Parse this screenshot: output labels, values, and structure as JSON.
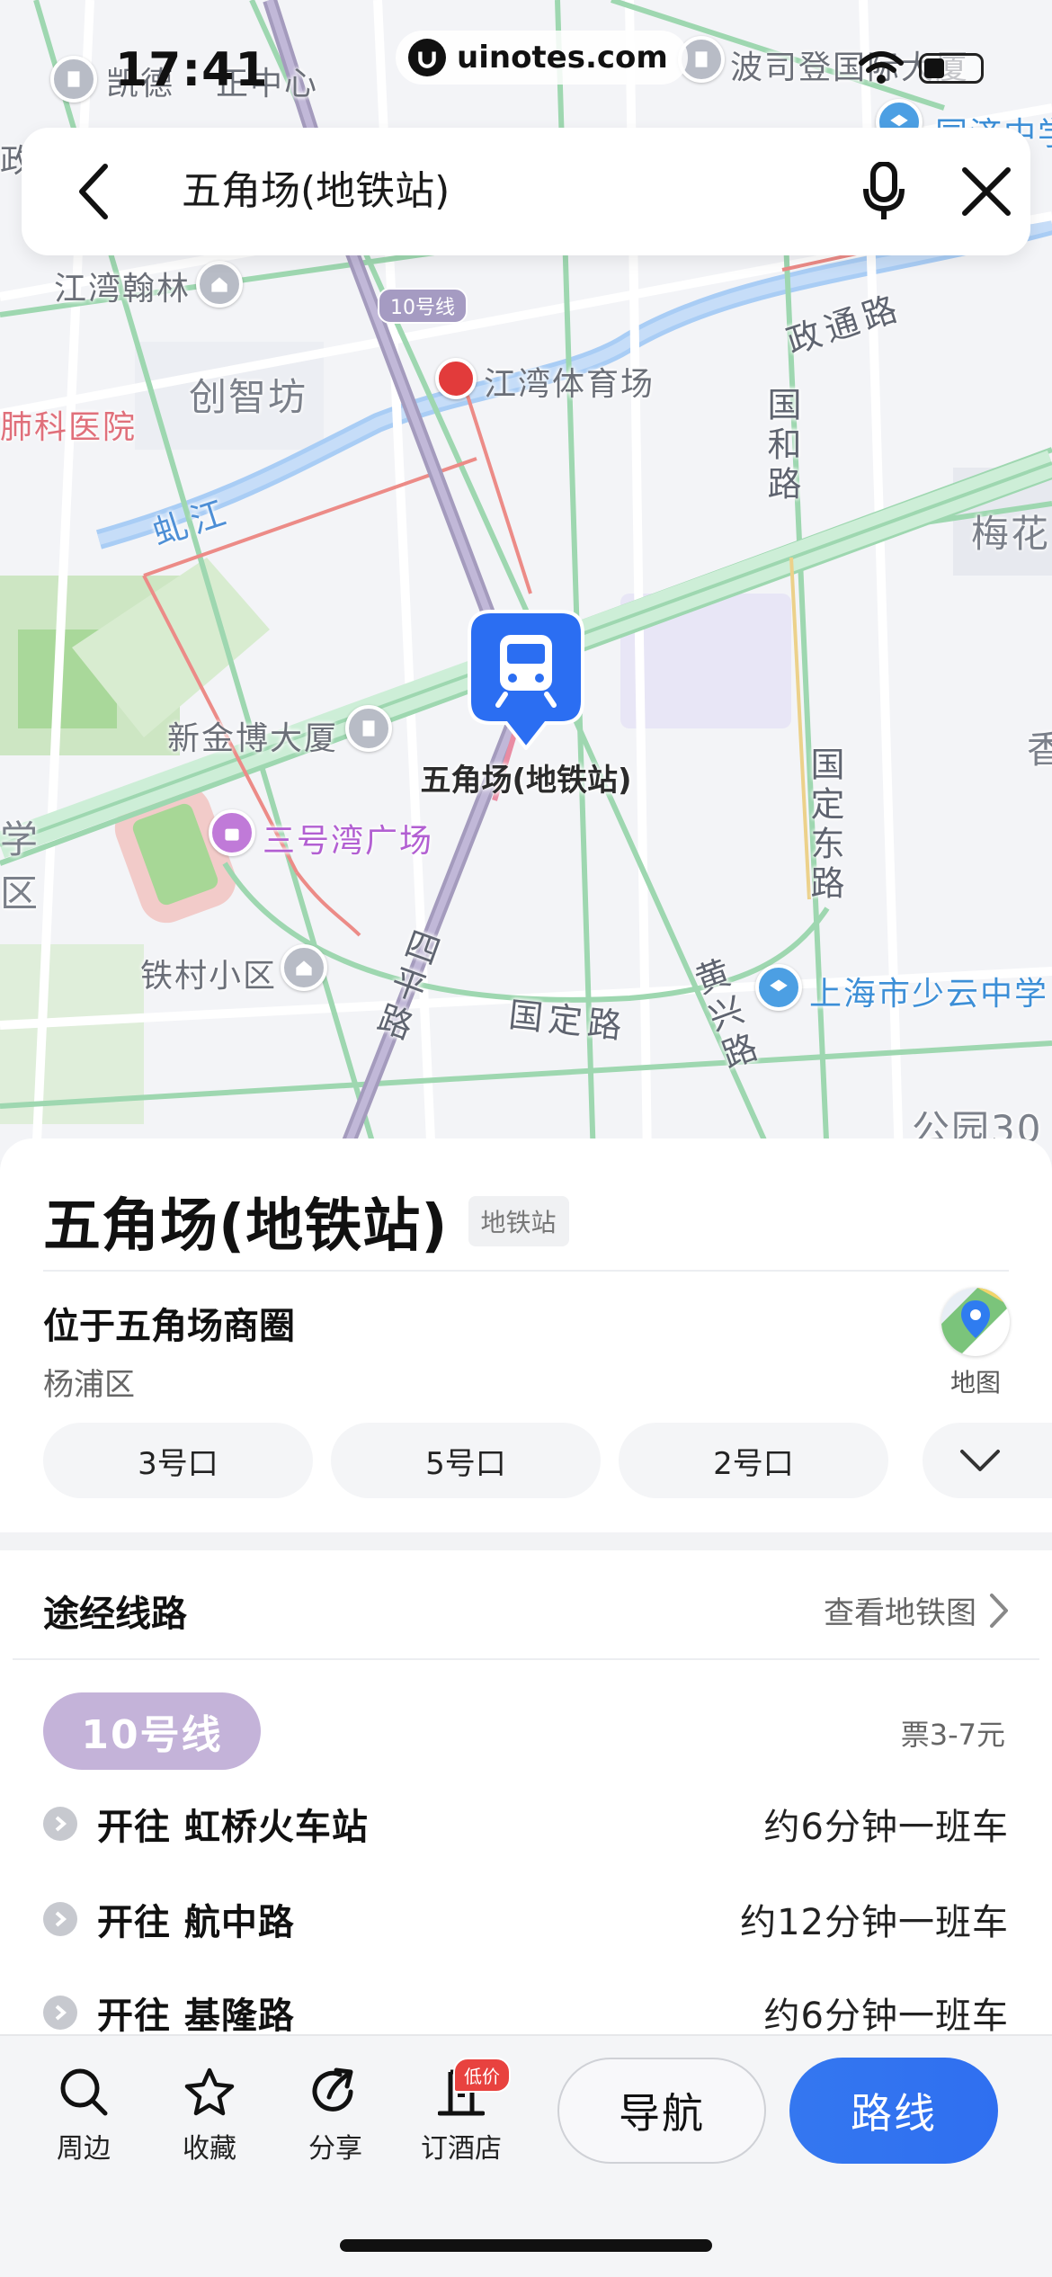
{
  "status_bar": {
    "time": "17:41",
    "watermark": "uinotes.com"
  },
  "search": {
    "query": "五角场(地铁站)"
  },
  "map": {
    "labels": {
      "kaide": "凯德",
      "zheng_center": "正中心",
      "bosi": "波司登国际大厦",
      "tongji": "同济中学",
      "jiangwan_hanlin": "江湾翰林",
      "chuangzhi": "创智坊",
      "jiangwan_stadium": "江湾体育场",
      "line10_tag": "10号线",
      "zhengtong_road": "政通路",
      "guohe_road": "国和路",
      "meihua": "梅花",
      "hospital": "肺科医院",
      "hongjiang": "虬江",
      "xinjinbo": "新金博大厦",
      "sanhaowan": "三号湾广场",
      "guoding_east": "国定东路",
      "xiang": "香",
      "xue": "学",
      "qu": "区",
      "tiecun": "铁村小区",
      "siping_road": "四平路",
      "guoding_road": "国定路",
      "huangxing_road": "黄兴路",
      "shaoyun_school": "上海市少云中学",
      "park": "公园30",
      "zheng": "政",
      "pin_label": "五角场(地铁站)"
    }
  },
  "place": {
    "name": "五角场(地铁站)",
    "type": "地铁站",
    "located": "位于五角场商圈",
    "district": "杨浦区",
    "map_button": "地图",
    "exits": [
      "3号口",
      "5号口",
      "2号口"
    ]
  },
  "routes": {
    "header": "途经线路",
    "view_map": "查看地铁图",
    "line": "10号线",
    "fare": "票3-7元",
    "directions": [
      {
        "dest": "开往 虹桥火车站",
        "freq": "约6分钟一班车"
      },
      {
        "dest": "开往 航中路",
        "freq": "约12分钟一班车"
      },
      {
        "dest": "开往 基隆路",
        "freq": "约6分钟一班车"
      }
    ]
  },
  "bottom_bar": {
    "nearby": "周边",
    "favorite": "收藏",
    "share": "分享",
    "hotel": "订酒店",
    "hotel_badge": "低价",
    "navigate": "导航",
    "route": "路线"
  },
  "colors": {
    "accent": "#2f6ff0",
    "line10": "#c4b3d9",
    "pin": "#2b6ef2"
  }
}
